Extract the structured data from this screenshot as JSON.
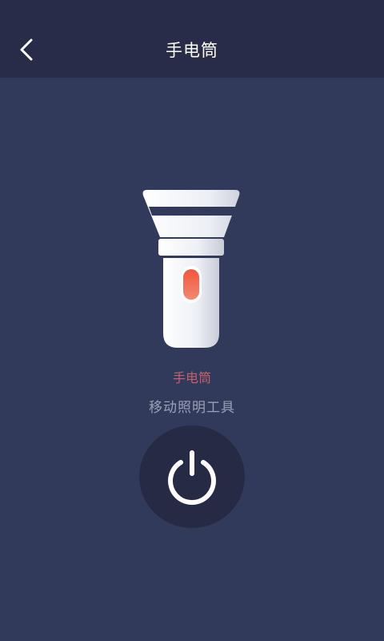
{
  "header": {
    "back_icon": "chevron-left-icon",
    "title": "手电筒"
  },
  "main": {
    "app_name": "手电筒",
    "app_description": "移动照明工具",
    "flashlight_icon": "flashlight-icon",
    "power_icon": "power-icon",
    "power_state": "off"
  },
  "colors": {
    "background": "#323a5c",
    "header_background": "#282c48",
    "power_button_background": "#262a45",
    "app_name_text": "#c4606a",
    "description_text": "#9aa0b8",
    "accent_switch": "#ee6a55"
  }
}
